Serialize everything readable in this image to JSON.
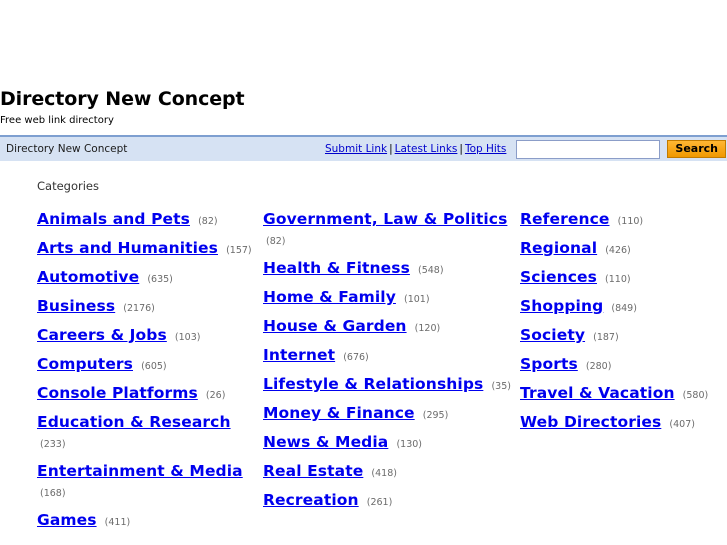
{
  "site": {
    "title": "Directory New Concept",
    "tagline": "Free web link directory"
  },
  "nav": {
    "breadcrumb": "Directory New Concept",
    "links": [
      {
        "label": "Submit Link"
      },
      {
        "label": "Latest Links"
      },
      {
        "label": "Top Hits"
      }
    ],
    "separator": "|",
    "search": {
      "value": "",
      "placeholder": "",
      "button_label": "Search"
    }
  },
  "main": {
    "section_label": "Categories",
    "columns": [
      {
        "items": [
          {
            "name": "Animals and Pets",
            "count": "(82)"
          },
          {
            "name": "Arts and Humanities",
            "count": "(157)"
          },
          {
            "name": "Automotive",
            "count": "(635)"
          },
          {
            "name": "Business",
            "count": "(2176)"
          },
          {
            "name": "Careers & Jobs",
            "count": "(103)"
          },
          {
            "name": "Computers",
            "count": "(605)"
          },
          {
            "name": "Console Platforms",
            "count": "(26)"
          },
          {
            "name": "Education & Research",
            "count": "(233)"
          },
          {
            "name": "Entertainment & Media",
            "count": "(168)"
          },
          {
            "name": "Games",
            "count": "(411)"
          }
        ]
      },
      {
        "items": [
          {
            "name": "Government, Law & Politics",
            "count": "(82)"
          },
          {
            "name": "Health & Fitness",
            "count": "(548)"
          },
          {
            "name": "Home & Family",
            "count": "(101)"
          },
          {
            "name": "House & Garden",
            "count": "(120)"
          },
          {
            "name": "Internet",
            "count": "(676)"
          },
          {
            "name": "Lifestyle & Relationships",
            "count": "(35)"
          },
          {
            "name": "Money & Finance",
            "count": "(295)"
          },
          {
            "name": "News & Media",
            "count": "(130)"
          },
          {
            "name": "Real Estate",
            "count": "(418)"
          },
          {
            "name": "Recreation",
            "count": "(261)"
          }
        ]
      },
      {
        "items": [
          {
            "name": "Reference",
            "count": "(110)"
          },
          {
            "name": "Regional",
            "count": "(426)"
          },
          {
            "name": "Sciences",
            "count": "(110)"
          },
          {
            "name": "Shopping",
            "count": "(849)"
          },
          {
            "name": "Society",
            "count": "(187)"
          },
          {
            "name": "Sports",
            "count": "(280)"
          },
          {
            "name": "Travel & Vacation",
            "count": "(580)"
          },
          {
            "name": "Web Directories",
            "count": "(407)"
          }
        ]
      }
    ]
  },
  "colors": {
    "link": "#0000ee",
    "navbar_bg": "#d6e2f3",
    "navbar_border": "#7e9fd0",
    "button_bg": "#f5a623",
    "count_text": "#6b6b6b"
  }
}
